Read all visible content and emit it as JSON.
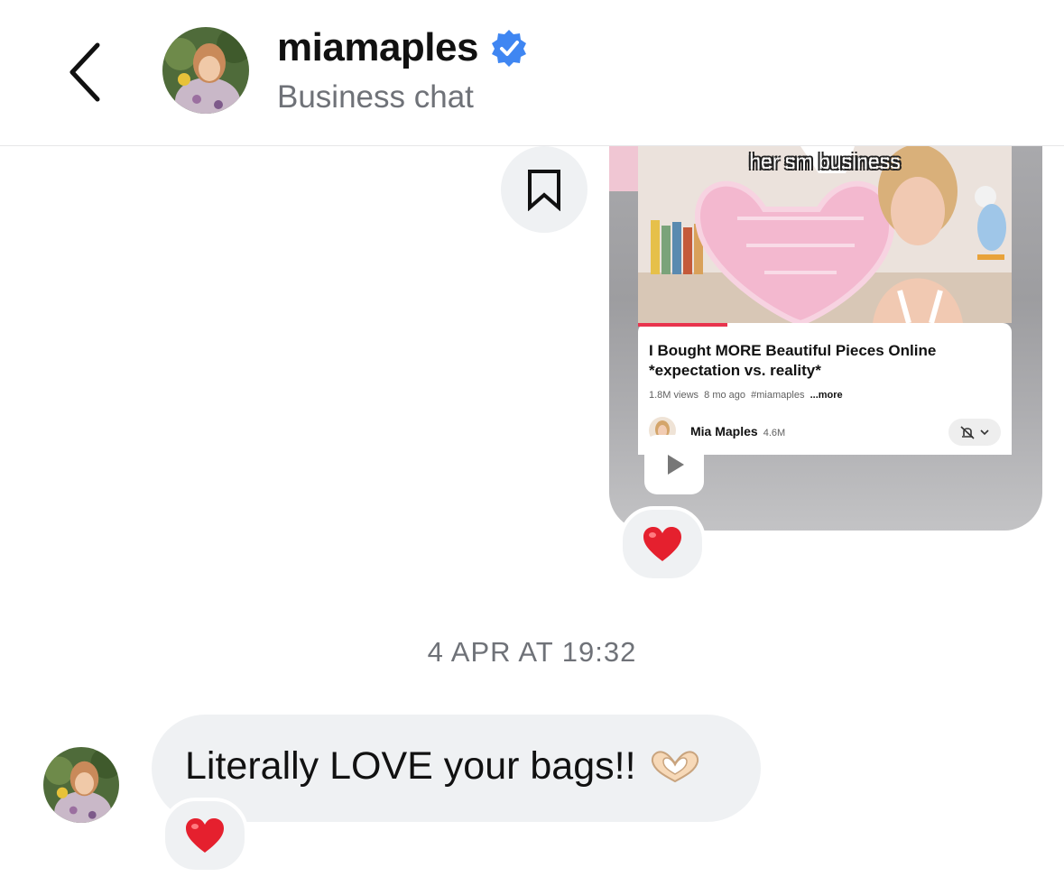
{
  "header": {
    "username": "miamaples",
    "subtitle": "Business chat",
    "verified": true,
    "accent_color": "#3f86f2"
  },
  "shared_post": {
    "overlay_caption": "her sm  business",
    "video_title": "I Bought MORE Beautiful Pieces Online *expectation vs. reality*",
    "views": "1.8M views",
    "age": "8 mo ago",
    "hashtag": "#miamaples",
    "more_label": "...more",
    "channel_name": "Mia Maples",
    "subscribers": "4.6M",
    "progress_fraction": 0.24,
    "progress_color": "#e8344e"
  },
  "reactions": {
    "post": "heart",
    "message": "heart"
  },
  "timestamp": "4 APR AT 19:32",
  "message": {
    "text": "Literally LOVE your bags!!",
    "emoji": "heart-hands"
  },
  "icons": {
    "back": "chevron-left-icon",
    "verified": "verified-badge-icon",
    "save": "bookmark-icon",
    "play": "play-icon",
    "bell": "bell-off-icon"
  }
}
